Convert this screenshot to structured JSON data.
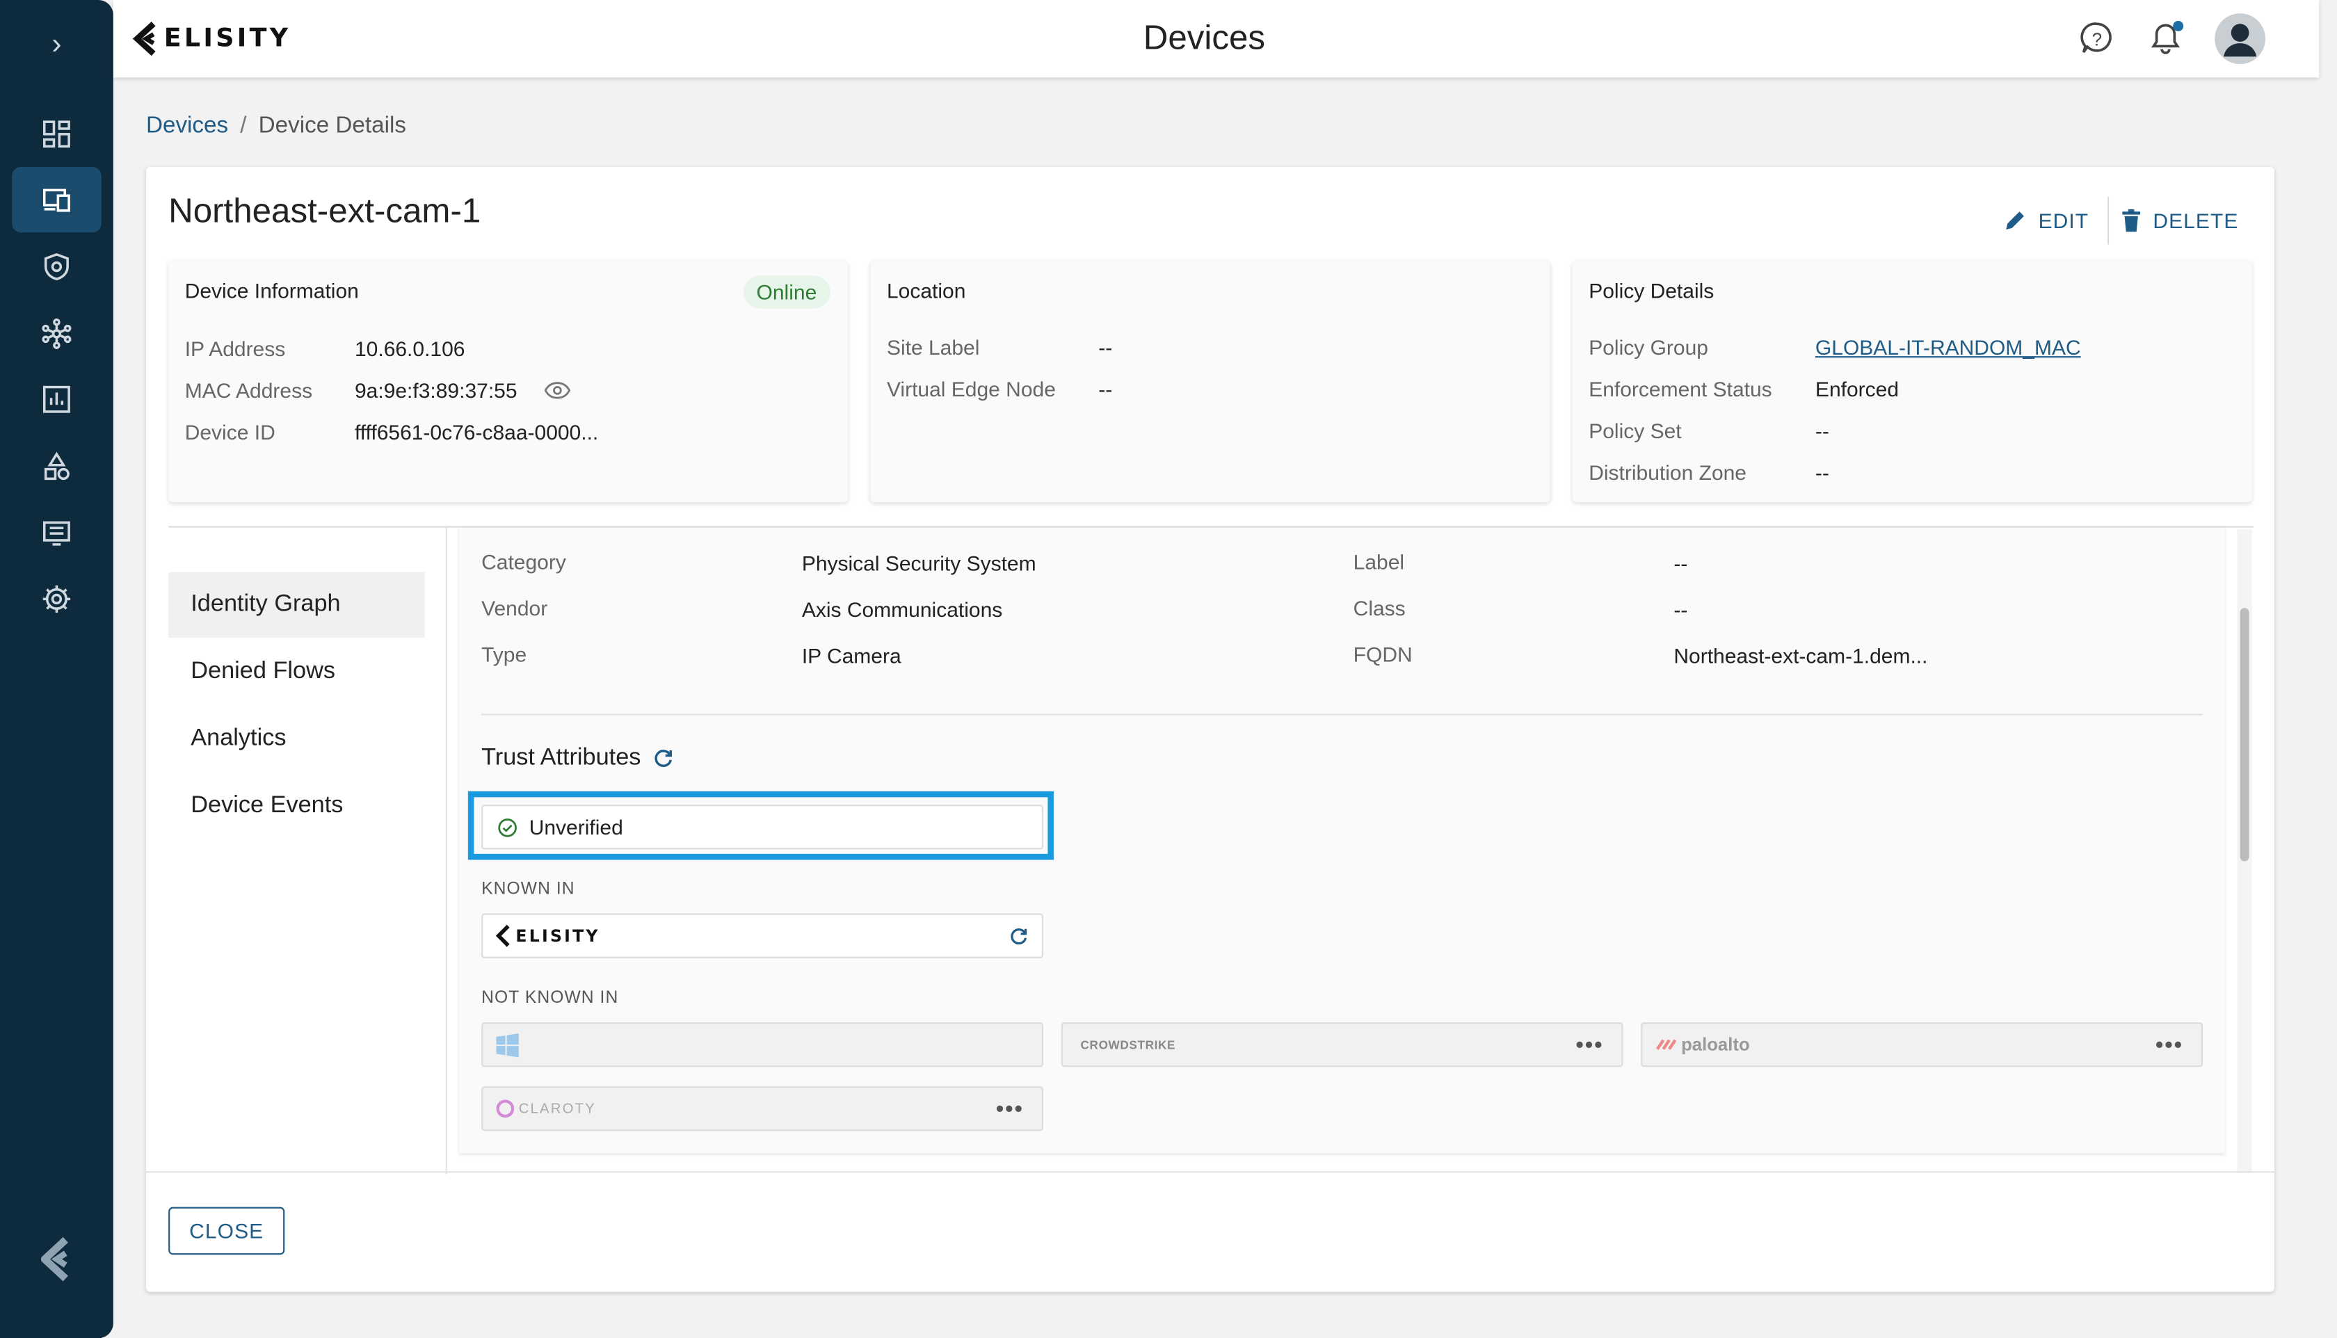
{
  "header": {
    "brand": "ELISITY",
    "title": "Devices"
  },
  "breadcrumb": {
    "root": "Devices",
    "separator": "/",
    "current": "Device Details"
  },
  "device": {
    "name": "Northeast-ext-cam-1",
    "edit_label": "EDIT",
    "delete_label": "DELETE"
  },
  "device_info": {
    "title": "Device Information",
    "status": "Online",
    "rows": [
      {
        "label": "IP Address",
        "value": "10.66.0.106"
      },
      {
        "label": "MAC Address",
        "value": "9a:9e:f3:89:37:55"
      },
      {
        "label": "Device ID",
        "value": "ffff6561-0c76-c8aa-0000..."
      }
    ]
  },
  "location": {
    "title": "Location",
    "rows": [
      {
        "label": "Site Label",
        "value": "--"
      },
      {
        "label": "Virtual Edge Node",
        "value": "--"
      }
    ]
  },
  "policy": {
    "title": "Policy Details",
    "rows": [
      {
        "label": "Policy Group",
        "value": "GLOBAL-IT-RANDOM_MAC"
      },
      {
        "label": "Enforcement Status",
        "value": "Enforced"
      },
      {
        "label": "Policy Set",
        "value": "--"
      },
      {
        "label": "Distribution Zone",
        "value": "--"
      }
    ]
  },
  "tabs": [
    "Identity Graph",
    "Denied Flows",
    "Analytics",
    "Device Events"
  ],
  "attributes": {
    "left": [
      {
        "label": "Category",
        "value": "Physical Security System"
      },
      {
        "label": "Vendor",
        "value": "Axis Communications"
      },
      {
        "label": "Type",
        "value": "IP Camera"
      }
    ],
    "right": [
      {
        "label": "Label",
        "value": "--"
      },
      {
        "label": "Class",
        "value": "--"
      },
      {
        "label": "FQDN",
        "value": "Northeast-ext-cam-1.dem..."
      }
    ]
  },
  "trust": {
    "title": "Trust Attributes",
    "status": "Unverified",
    "known_in_label": "KNOWN IN",
    "known_in": [
      "ELISITY"
    ],
    "not_known_in_label": "NOT KNOWN IN",
    "not_known_in": [
      "CROWDSTRIKE",
      "paloalto",
      "CLAROTY"
    ]
  },
  "footer": {
    "close_label": "CLOSE"
  },
  "colors": {
    "sidebar": "#0e2a3d",
    "accent": "#1e5b86",
    "highlight": "#1a9be0",
    "online": "#2e7d32"
  }
}
